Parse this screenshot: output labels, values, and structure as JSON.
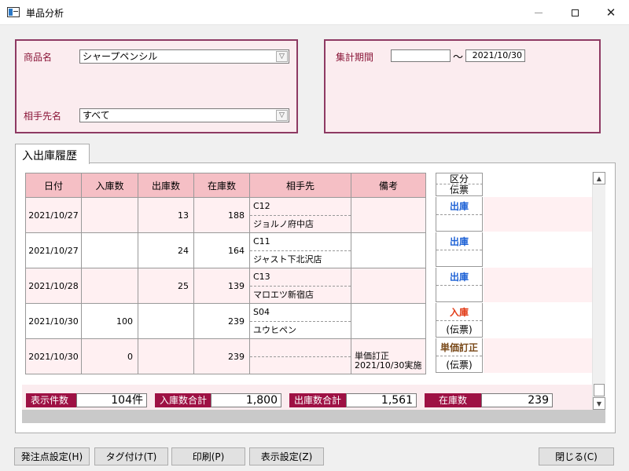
{
  "window": {
    "title": "単品分析",
    "icon": "app-window-icon",
    "min_icon": "minimize-icon",
    "max_icon": "maximize-icon",
    "close_label": "✕"
  },
  "filter": {
    "product_label": "商品名",
    "product_value": "シャープペンシル",
    "partner_label": "相手先名",
    "partner_value": "すべて",
    "dropdown_glyph": "▽"
  },
  "period": {
    "label": "集計期間",
    "from_value": "",
    "separator": "～",
    "to_value": "2021/10/30"
  },
  "tab": {
    "label": "入出庫履歴"
  },
  "grid": {
    "headers": [
      "日付",
      "入庫数",
      "出庫数",
      "在庫数",
      "相手先",
      "備考"
    ],
    "rows": [
      {
        "date": "2021/10/27",
        "in": "",
        "out": "13",
        "stock": "188",
        "partner_code": "C12",
        "partner_name": "ジョルノ府中店",
        "note1": "",
        "note2": ""
      },
      {
        "date": "2021/10/27",
        "in": "",
        "out": "24",
        "stock": "164",
        "partner_code": "C11",
        "partner_name": "ジャスト下北沢店",
        "note1": "",
        "note2": ""
      },
      {
        "date": "2021/10/28",
        "in": "",
        "out": "25",
        "stock": "139",
        "partner_code": "C13",
        "partner_name": "マロエツ新宿店",
        "note1": "",
        "note2": ""
      },
      {
        "date": "2021/10/30",
        "in": "100",
        "out": "",
        "stock": "239",
        "partner_code": "S04",
        "partner_name": "ユウヒペン",
        "note1": "",
        "note2": ""
      },
      {
        "date": "2021/10/30",
        "in": "0",
        "out": "",
        "stock": "239",
        "partner_code": "",
        "partner_name": "",
        "note1": "単価訂正",
        "note2": "2021/10/30実施"
      }
    ]
  },
  "section": {
    "header_top": "区分",
    "header_bottom": "伝票",
    "rows": [
      {
        "kind": "出庫",
        "slip": "",
        "color": "#1f63d6"
      },
      {
        "kind": "出庫",
        "slip": "",
        "color": "#1f63d6"
      },
      {
        "kind": "出庫",
        "slip": "",
        "color": "#1f63d6"
      },
      {
        "kind": "入庫",
        "slip": "(伝票)",
        "color": "#e23b17"
      },
      {
        "kind": "単価訂正",
        "slip": "(伝票)",
        "color": "#7a4a1a"
      }
    ]
  },
  "summary": {
    "count_label": "表示件数",
    "count_value": "104件",
    "in_total_label": "入庫数合計",
    "in_total_value": "1,800",
    "out_total_label": "出庫数合計",
    "out_total_value": "1,561",
    "stock_label": "在庫数",
    "stock_value": "239"
  },
  "buttons": {
    "reorder": "発注点設定(H)",
    "tag": "タグ付け(T)",
    "print": "印刷(P)",
    "display": "表示設定(Z)",
    "close": "閉じる(C)"
  },
  "colors": {
    "panel_border": "#8e3a63",
    "panel_bg": "#fbecef",
    "header_bg": "#f5bfc5",
    "label_bg": "#9e1144",
    "out_color": "#1f63d6",
    "in_color": "#e23b17"
  }
}
